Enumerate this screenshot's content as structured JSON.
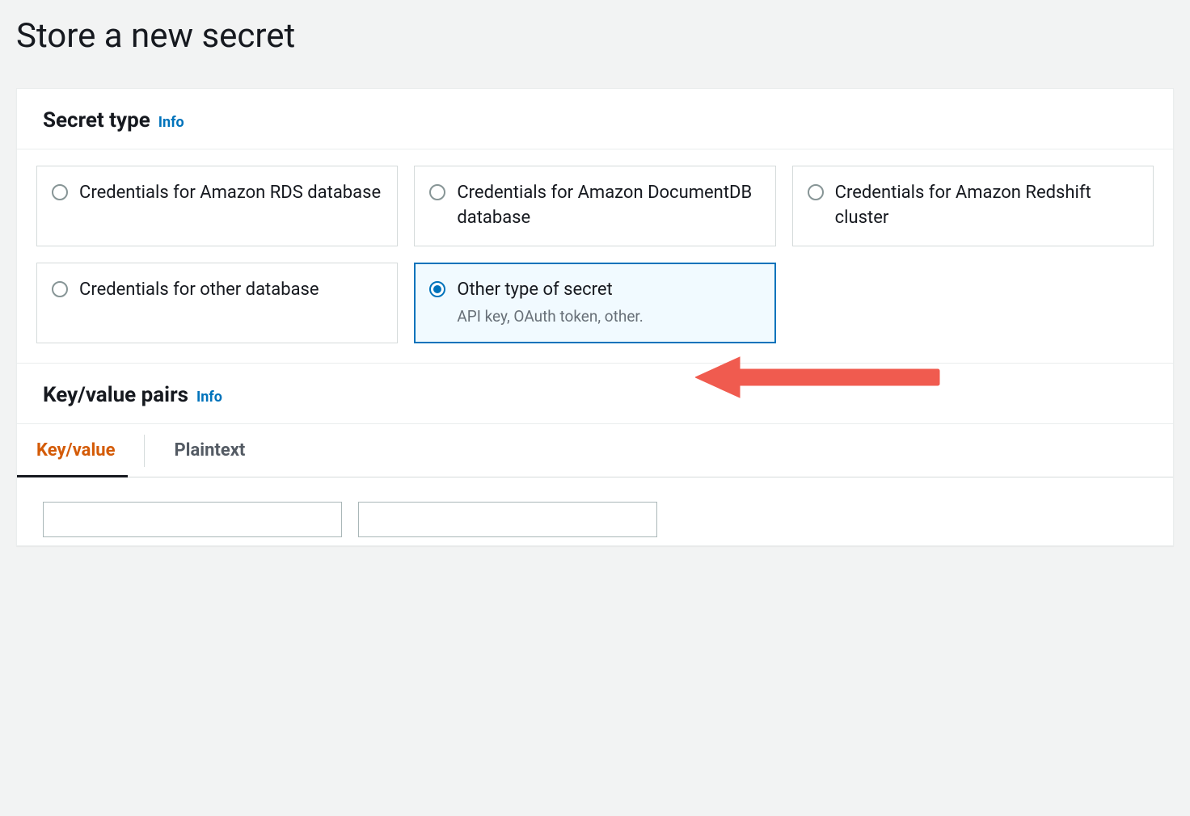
{
  "page": {
    "title": "Store a new secret"
  },
  "secret_type_panel": {
    "title": "Secret type",
    "info_label": "Info",
    "options": [
      {
        "label": "Credentials for Amazon RDS database",
        "description": ""
      },
      {
        "label": "Credentials for Amazon DocumentDB database",
        "description": ""
      },
      {
        "label": "Credentials for Amazon Redshift cluster",
        "description": ""
      },
      {
        "label": "Credentials for other database",
        "description": ""
      },
      {
        "label": "Other type of secret",
        "description": "API key, OAuth token, other."
      }
    ],
    "selected_index": 4
  },
  "kv_panel": {
    "title": "Key/value pairs",
    "info_label": "Info",
    "tabs": [
      {
        "label": "Key/value",
        "active": true
      },
      {
        "label": "Plaintext",
        "active": false
      }
    ],
    "key_input_value": "",
    "value_input_value": ""
  },
  "colors": {
    "accent_blue": "#0073bb",
    "accent_orange": "#d45b07",
    "annotation_red": "#f05b4f"
  }
}
